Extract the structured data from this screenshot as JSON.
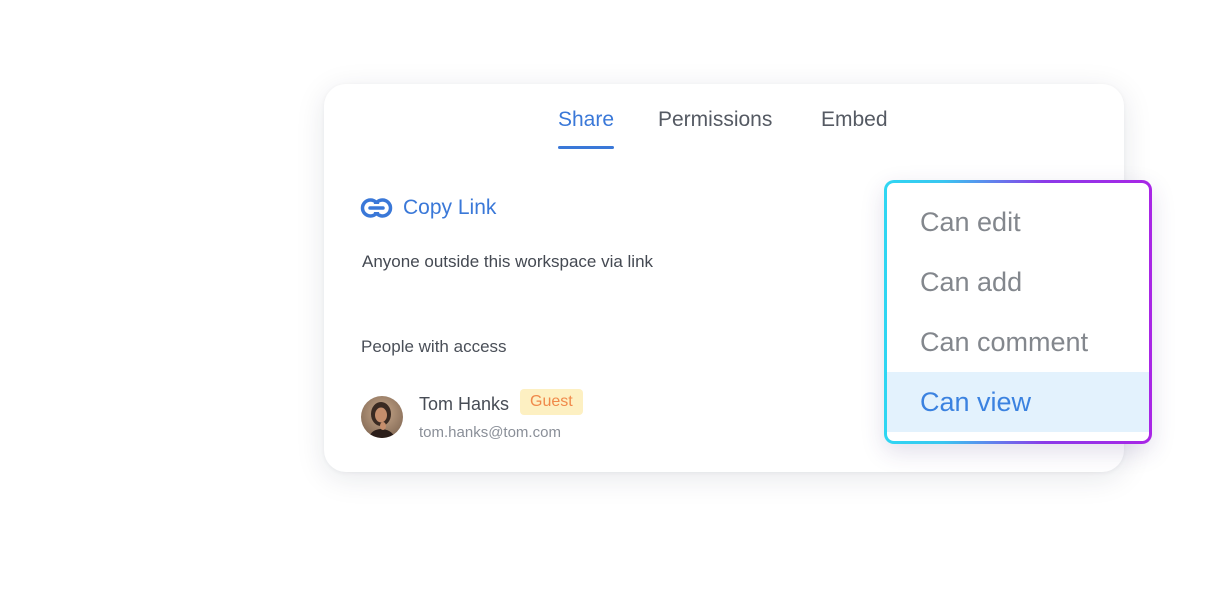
{
  "tabs": [
    {
      "label": "Share",
      "active": true
    },
    {
      "label": "Permissions",
      "active": false
    },
    {
      "label": "Embed",
      "active": false
    }
  ],
  "copy_link": {
    "label": "Copy Link",
    "icon": "link-icon"
  },
  "link_access_text": "Anyone outside this workspace via link",
  "people_section": {
    "title": "People with access",
    "users": [
      {
        "name": "Tom Hanks",
        "badge": "Guest",
        "email": "tom.hanks@tom.com",
        "avatar": "avatar-photo"
      }
    ]
  },
  "permission_dropdown": {
    "options": [
      "Can edit",
      "Can add",
      "Can comment",
      "Can view"
    ],
    "selected": "Can view"
  },
  "colors": {
    "accent": "#3a78d8",
    "badge_bg": "#fdf0c2",
    "badge_text": "#f0894a",
    "selected_bg": "#e3f2fd",
    "gradient_start": "#2fd6f2",
    "gradient_end": "#a925e6"
  }
}
